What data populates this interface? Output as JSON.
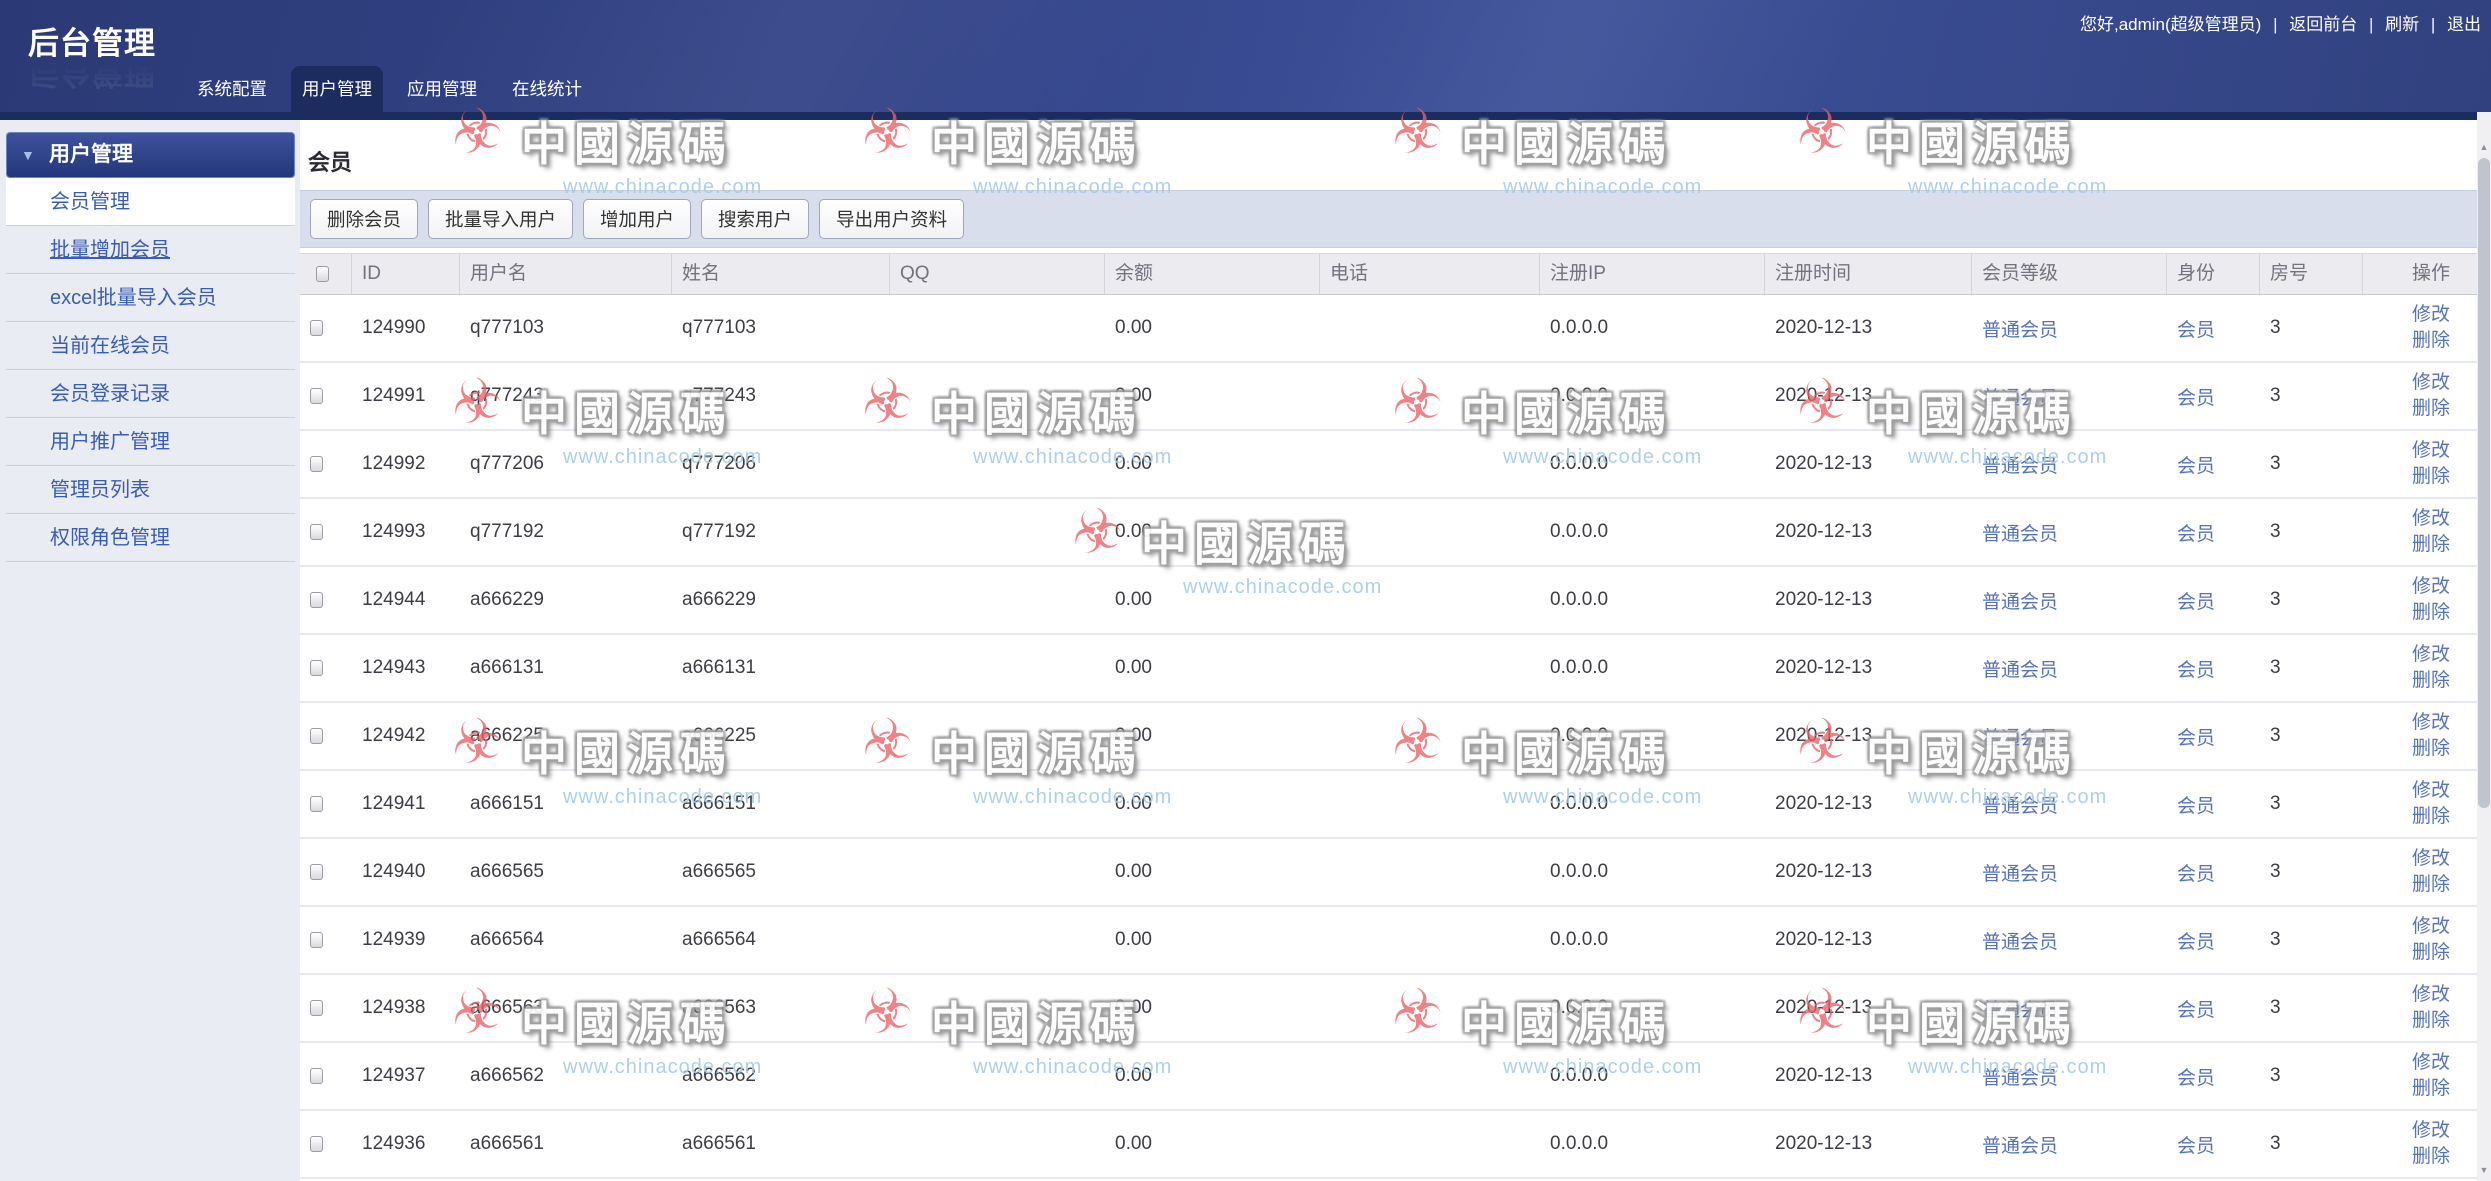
{
  "header": {
    "logo": "后台管理",
    "nav": [
      {
        "label": "系统配置",
        "active": false
      },
      {
        "label": "用户管理",
        "active": true
      },
      {
        "label": "应用管理",
        "active": false
      },
      {
        "label": "在线统计",
        "active": false
      }
    ],
    "user": {
      "greeting": "您好,admin(超级管理员)",
      "separator": "|",
      "links": [
        "返回前台",
        "刷新",
        "退出"
      ]
    }
  },
  "sidebar": {
    "group_title": "用户管理",
    "collapse_icon": "▼",
    "items": [
      {
        "label": "会员管理",
        "active": true,
        "underlined": false
      },
      {
        "label": "批量增加会员",
        "active": false,
        "underlined": true
      },
      {
        "label": "excel批量导入会员",
        "active": false,
        "underlined": false
      },
      {
        "label": "当前在线会员",
        "active": false,
        "underlined": false
      },
      {
        "label": "会员登录记录",
        "active": false,
        "underlined": false
      },
      {
        "label": "用户推广管理",
        "active": false,
        "underlined": false
      },
      {
        "label": "管理员列表",
        "active": false,
        "underlined": false
      },
      {
        "label": "权限角色管理",
        "active": false,
        "underlined": false
      }
    ]
  },
  "main": {
    "title": "会员",
    "toolbar": [
      {
        "label": "删除会员"
      },
      {
        "label": "批量导入用户"
      },
      {
        "label": "增加用户"
      },
      {
        "label": "搜索用户"
      },
      {
        "label": "导出用户资料"
      }
    ],
    "table": {
      "columns": [
        "ID",
        "用户名",
        "姓名",
        "QQ",
        "余额",
        "电话",
        "注册IP",
        "注册时间",
        "会员等级",
        "身份",
        "房号",
        "操作"
      ],
      "action_edit": "修改",
      "action_delete": "删除",
      "rows": [
        {
          "id": "124990",
          "username": "q777103",
          "name": "q777103",
          "qq": "",
          "balance": "0.00",
          "phone": "",
          "reg_ip": "0.0.0.0",
          "reg_time": "2020-12-13",
          "level": "普通会员",
          "identity": "会员",
          "room": "3"
        },
        {
          "id": "124991",
          "username": "q777243",
          "name": "q777243",
          "qq": "",
          "balance": "0.00",
          "phone": "",
          "reg_ip": "0.0.0.0",
          "reg_time": "2020-12-13",
          "level": "普通会员",
          "identity": "会员",
          "room": "3"
        },
        {
          "id": "124992",
          "username": "q777206",
          "name": "q777206",
          "qq": "",
          "balance": "0.00",
          "phone": "",
          "reg_ip": "0.0.0.0",
          "reg_time": "2020-12-13",
          "level": "普通会员",
          "identity": "会员",
          "room": "3"
        },
        {
          "id": "124993",
          "username": "q777192",
          "name": "q777192",
          "qq": "",
          "balance": "0.00",
          "phone": "",
          "reg_ip": "0.0.0.0",
          "reg_time": "2020-12-13",
          "level": "普通会员",
          "identity": "会员",
          "room": "3"
        },
        {
          "id": "124944",
          "username": "a666229",
          "name": "a666229",
          "qq": "",
          "balance": "0.00",
          "phone": "",
          "reg_ip": "0.0.0.0",
          "reg_time": "2020-12-13",
          "level": "普通会员",
          "identity": "会员",
          "room": "3"
        },
        {
          "id": "124943",
          "username": "a666131",
          "name": "a666131",
          "qq": "",
          "balance": "0.00",
          "phone": "",
          "reg_ip": "0.0.0.0",
          "reg_time": "2020-12-13",
          "level": "普通会员",
          "identity": "会员",
          "room": "3"
        },
        {
          "id": "124942",
          "username": "a666225",
          "name": "a666225",
          "qq": "",
          "balance": "0.00",
          "phone": "",
          "reg_ip": "0.0.0.0",
          "reg_time": "2020-12-13",
          "level": "普通会员",
          "identity": "会员",
          "room": "3"
        },
        {
          "id": "124941",
          "username": "a666151",
          "name": "a666151",
          "qq": "",
          "balance": "0.00",
          "phone": "",
          "reg_ip": "0.0.0.0",
          "reg_time": "2020-12-13",
          "level": "普通会员",
          "identity": "会员",
          "room": "3"
        },
        {
          "id": "124940",
          "username": "a666565",
          "name": "a666565",
          "qq": "",
          "balance": "0.00",
          "phone": "",
          "reg_ip": "0.0.0.0",
          "reg_time": "2020-12-13",
          "level": "普通会员",
          "identity": "会员",
          "room": "3"
        },
        {
          "id": "124939",
          "username": "a666564",
          "name": "a666564",
          "qq": "",
          "balance": "0.00",
          "phone": "",
          "reg_ip": "0.0.0.0",
          "reg_time": "2020-12-13",
          "level": "普通会员",
          "identity": "会员",
          "room": "3"
        },
        {
          "id": "124938",
          "username": "a666563",
          "name": "a666563",
          "qq": "",
          "balance": "0.00",
          "phone": "",
          "reg_ip": "0.0.0.0",
          "reg_time": "2020-12-13",
          "level": "普通会员",
          "identity": "会员",
          "room": "3"
        },
        {
          "id": "124937",
          "username": "a666562",
          "name": "a666562",
          "qq": "",
          "balance": "0.00",
          "phone": "",
          "reg_ip": "0.0.0.0",
          "reg_time": "2020-12-13",
          "level": "普通会员",
          "identity": "会员",
          "room": "3"
        },
        {
          "id": "124936",
          "username": "a666561",
          "name": "a666561",
          "qq": "",
          "balance": "0.00",
          "phone": "",
          "reg_ip": "0.0.0.0",
          "reg_time": "2020-12-13",
          "level": "普通会员",
          "identity": "会员",
          "room": "3"
        }
      ]
    }
  },
  "watermark": {
    "icon": "☣",
    "brand": "中國源碼",
    "url": "www.chinacode.com"
  }
}
